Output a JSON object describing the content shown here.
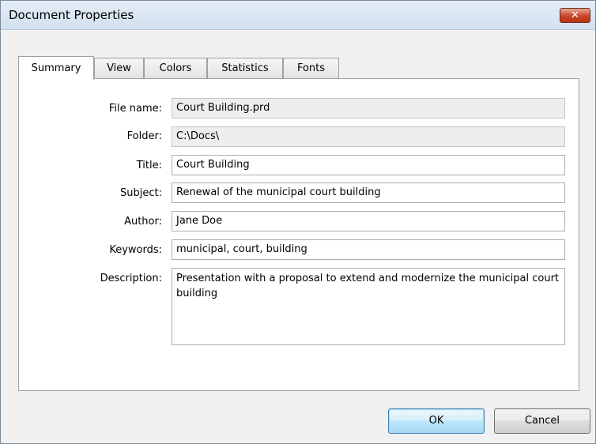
{
  "window": {
    "title": "Document Properties",
    "close_glyph": "✕"
  },
  "tabs": [
    {
      "label": "Summary",
      "active": true
    },
    {
      "label": "View",
      "active": false
    },
    {
      "label": "Colors",
      "active": false
    },
    {
      "label": "Statistics",
      "active": false
    },
    {
      "label": "Fonts",
      "active": false
    }
  ],
  "summary": {
    "file_name": {
      "label": "File name:",
      "value": "Court Building.prd"
    },
    "folder": {
      "label": "Folder:",
      "value": "C:\\Docs\\"
    },
    "title": {
      "label": "Title:",
      "value": "Court Building"
    },
    "subject": {
      "label": "Subject:",
      "value": "Renewal of the municipal court building"
    },
    "author": {
      "label": "Author:",
      "value": "Jane Doe"
    },
    "keywords": {
      "label": "Keywords:",
      "value": "municipal, court, building"
    },
    "description": {
      "label": "Description:",
      "value": "Presentation with a proposal to extend and modernize the municipal court building"
    }
  },
  "buttons": {
    "ok": "OK",
    "cancel": "Cancel"
  },
  "colors": {
    "default_button_border": "#3c7fb1",
    "close_button": "#c7452a"
  }
}
